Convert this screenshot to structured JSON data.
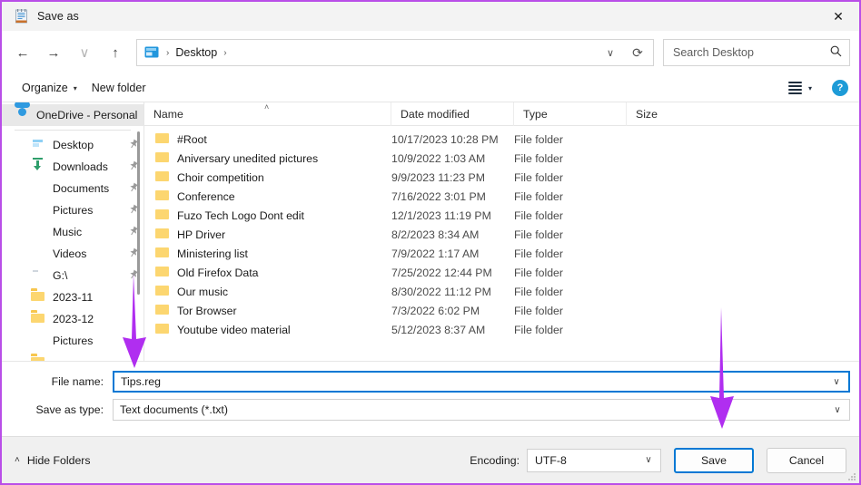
{
  "window": {
    "title": "Save as",
    "app_icon": "notepad-icon",
    "close_label": "✕",
    "border_color": "#b94ee8"
  },
  "nav": {
    "back": "←",
    "forward": "→",
    "recent": "∨",
    "up": "↑",
    "refresh": "⟳",
    "address_chevron": "∨"
  },
  "address": {
    "icon": "desktop-icon",
    "crumbs": [
      "Desktop"
    ],
    "separator": "›"
  },
  "search": {
    "placeholder": "Search Desktop",
    "icon": "⌕"
  },
  "commandbar": {
    "organize": "Organize",
    "organize_caret": "▾",
    "new_folder": "New folder",
    "view_caret": "▾",
    "help": "?"
  },
  "sidebar": {
    "items": [
      {
        "label": "OneDrive - Personal",
        "icon": "cloud-icon",
        "selected": true,
        "pinned": false,
        "indent": false
      },
      {
        "label": "Desktop",
        "icon": "desktop-icon",
        "selected": false,
        "pinned": true,
        "indent": true
      },
      {
        "label": "Downloads",
        "icon": "download-icon",
        "selected": false,
        "pinned": true,
        "indent": true
      },
      {
        "label": "Documents",
        "icon": "document-icon",
        "selected": false,
        "pinned": true,
        "indent": true
      },
      {
        "label": "Pictures",
        "icon": "pictures-icon",
        "selected": false,
        "pinned": true,
        "indent": true
      },
      {
        "label": "Music",
        "icon": "music-icon",
        "selected": false,
        "pinned": true,
        "indent": true
      },
      {
        "label": "Videos",
        "icon": "video-icon",
        "selected": false,
        "pinned": true,
        "indent": true
      },
      {
        "label": "G:\\",
        "icon": "drive-icon",
        "selected": false,
        "pinned": true,
        "indent": true
      },
      {
        "label": "2023-11",
        "icon": "folder-icon",
        "selected": false,
        "pinned": false,
        "indent": true
      },
      {
        "label": "2023-12",
        "icon": "folder-icon",
        "selected": false,
        "pinned": false,
        "indent": true
      },
      {
        "label": "Pictures",
        "icon": "pictures-icon",
        "selected": false,
        "pinned": false,
        "indent": true
      }
    ],
    "pin_glyph": "📌"
  },
  "filelist": {
    "columns": [
      "Name",
      "Date modified",
      "Type",
      "Size"
    ],
    "sort_indicator": "˄",
    "rows": [
      {
        "name": "#Root",
        "date": "10/17/2023 10:28 PM",
        "type": "File folder",
        "size": ""
      },
      {
        "name": "Aniversary unedited pictures",
        "date": "10/9/2022 1:03 AM",
        "type": "File folder",
        "size": ""
      },
      {
        "name": "Choir competition",
        "date": "9/9/2023 11:23 PM",
        "type": "File folder",
        "size": ""
      },
      {
        "name": "Conference",
        "date": "7/16/2022 3:01 PM",
        "type": "File folder",
        "size": ""
      },
      {
        "name": "Fuzo Tech Logo Dont edit",
        "date": "12/1/2023 11:19 PM",
        "type": "File folder",
        "size": ""
      },
      {
        "name": "HP Driver",
        "date": "8/2/2023 8:34 AM",
        "type": "File folder",
        "size": ""
      },
      {
        "name": "Ministering list",
        "date": "7/9/2022 1:17 AM",
        "type": "File folder",
        "size": ""
      },
      {
        "name": "Old Firefox Data",
        "date": "7/25/2022 12:44 PM",
        "type": "File folder",
        "size": ""
      },
      {
        "name": "Our music",
        "date": "8/30/2022 11:12 PM",
        "type": "File folder",
        "size": ""
      },
      {
        "name": "Tor Browser",
        "date": "7/3/2022 6:02 PM",
        "type": "File folder",
        "size": ""
      },
      {
        "name": "Youtube video material",
        "date": "5/12/2023 8:37 AM",
        "type": "File folder",
        "size": ""
      }
    ]
  },
  "form": {
    "file_name_label": "File name:",
    "file_name_value": "Tips.reg",
    "save_as_type_label": "Save as type:",
    "save_as_type_value": "Text documents (*.txt)",
    "chevron": "∨"
  },
  "footer": {
    "hide_folders": "Hide Folders",
    "hide_folders_chevron": "˄",
    "encoding_label": "Encoding:",
    "encoding_value": "UTF-8",
    "encoding_chevron": "∨",
    "save_label": "Save",
    "cancel_label": "Cancel"
  },
  "annotations": {
    "arrow_color": "#b02ef0",
    "arrows": [
      {
        "name": "arrow-to-file-name-field",
        "points_to": "file-name-input"
      },
      {
        "name": "arrow-to-save-button",
        "points_to": "save-button"
      }
    ]
  }
}
